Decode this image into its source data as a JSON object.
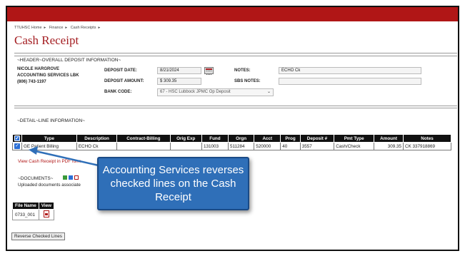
{
  "breadcrumb": [
    "TTUHSC Home",
    "Finance",
    "Cash Receipts"
  ],
  "page_title": "Cash Receipt",
  "header": {
    "section_label": "~HEADER~OVERALL DEPOSIT INFORMATION~",
    "contact_name": "NICOLE HARGROVE",
    "contact_dept": "ACCOUNTING SERVICES LBK",
    "contact_phone": "(806) 743-1197",
    "deposit_date_label": "DEPOSIT DATE:",
    "deposit_date_value": "8/21/2024",
    "deposit_amount_label": "DEPOSIT AMOUNT:",
    "deposit_amount_value": "$ 309.35",
    "bank_code_label": "BANK CODE:",
    "bank_code_value": "67 - HSC Lubbock JPMC Op Deposit",
    "notes_label": "NOTES:",
    "notes_value": "ECHO Ck",
    "sbs_notes_label": "SBS NOTES:",
    "sbs_notes_value": ""
  },
  "detail": {
    "section_label": "~DETAIL~LINE INFORMATION~",
    "columns": [
      "Type",
      "Description",
      "Contract-Billing",
      "Orig Exp",
      "Fund",
      "Orgn",
      "Acct",
      "Prog",
      "Deposit #",
      "Pmt Type",
      "Amount",
      "Notes"
    ],
    "rows": [
      {
        "checked": true,
        "cells": [
          "GE Patient Billing",
          "ECHO Ck",
          "",
          "",
          "131003",
          "511284",
          "520000",
          "40",
          "3557",
          "Cash/Check",
          "309.35",
          "CK 337918869"
        ]
      }
    ]
  },
  "pdf_link": "View Cash Receipt in PDF form",
  "documents": {
    "section_label": "~DOCUMENTS~",
    "uploaded_text": "Uploaded documents associate",
    "columns": [
      "File Name",
      "View"
    ],
    "rows": [
      {
        "file_name": "0733_001"
      }
    ]
  },
  "reverse_button": "Reverse Checked Lines",
  "callout": {
    "text": "Accounting Services reverses checked lines on the Cash Receipt"
  },
  "colors": {
    "brand_red": "#b01616",
    "callout_blue": "#2f6fb8",
    "checkbox_blue": "#2b6fd6"
  }
}
